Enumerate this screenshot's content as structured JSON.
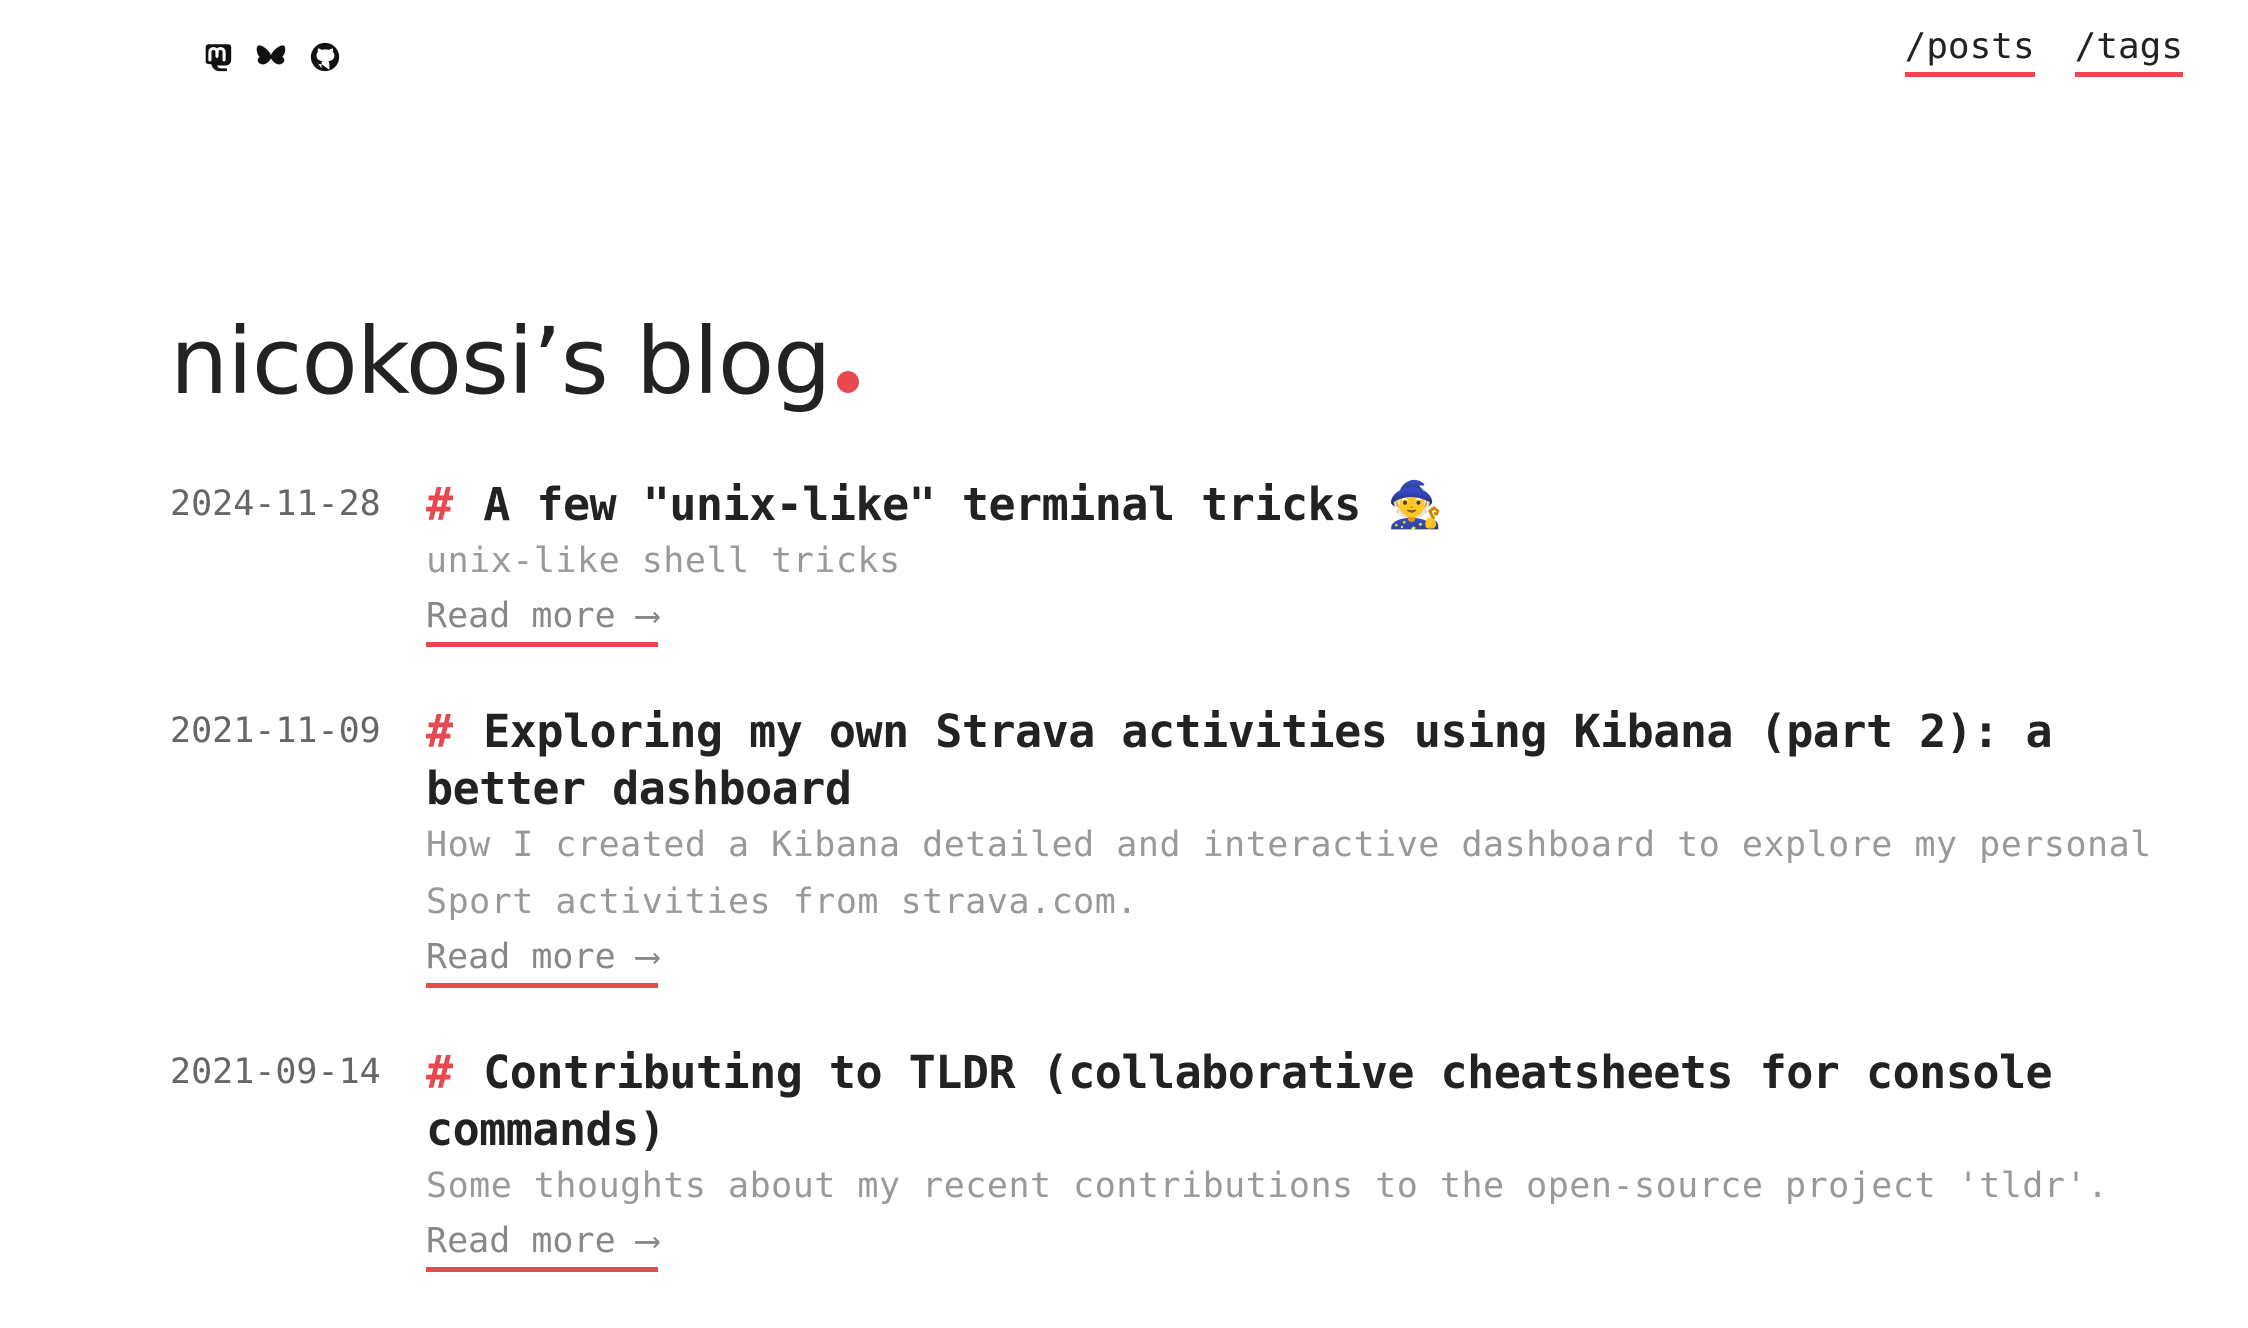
{
  "header": {
    "social": [
      {
        "icon": "mastodon-icon"
      },
      {
        "icon": "bluesky-icon"
      },
      {
        "icon": "github-icon"
      }
    ],
    "nav": {
      "posts": "/posts",
      "tags": "/tags"
    }
  },
  "site": {
    "title": "nicokosi’s blog"
  },
  "posts": [
    {
      "date": "2024-11-28",
      "hash": "#",
      "title": "A few \"unix-like\" terminal tricks 🧙",
      "summary": "unix-like shell tricks",
      "read_more": "Read more ⟶"
    },
    {
      "date": "2021-11-09",
      "hash": "#",
      "title": "Exploring my own Strava activities using Kibana (part 2): a better dashboard",
      "summary": "How I created a Kibana detailed and interactive dashboard to explore my personal Sport activities from strava.com.",
      "read_more": "Read more ⟶"
    },
    {
      "date": "2021-09-14",
      "hash": "#",
      "title": "Contributing to TLDR (collaborative cheatsheets for console commands)",
      "summary": "Some thoughts about my recent contributions to the open-source project 'tldr'.",
      "read_more": "Read more ⟶"
    }
  ],
  "colors": {
    "accent": "#e8484f",
    "text": "#222222",
    "muted": "#999999"
  }
}
